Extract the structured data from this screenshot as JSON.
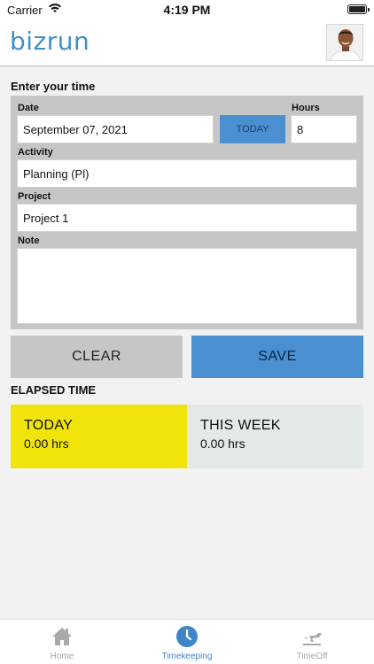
{
  "status_bar": {
    "carrier": "Carrier",
    "time": "4:19 PM"
  },
  "header": {
    "logo": "bizrun"
  },
  "entry": {
    "title": "Enter your time",
    "date_label": "Date",
    "date_value": "September 07, 2021",
    "today_button": "TODAY",
    "hours_label": "Hours",
    "hours_value": "8",
    "activity_label": "Activity",
    "activity_value": "Planning (Pl)",
    "project_label": "Project",
    "project_value": "Project 1",
    "note_label": "Note",
    "note_value": ""
  },
  "actions": {
    "clear": "CLEAR",
    "save": "SAVE"
  },
  "elapsed": {
    "title": "ELAPSED TIME",
    "today_label": "TODAY",
    "today_value": "0.00 hrs",
    "week_label": "THIS WEEK",
    "week_value": "0.00 hrs"
  },
  "tabs": [
    {
      "label": "Home",
      "icon": "home-icon",
      "active": false
    },
    {
      "label": "Timekeeping",
      "icon": "clock-icon",
      "active": true
    },
    {
      "label": "TimeOff",
      "icon": "airplane-icon",
      "active": false
    }
  ],
  "colors": {
    "brand": "#3e8fca",
    "accent": "#4a90d0",
    "today_card": "#f0e40a",
    "week_card": "#e3e9e5",
    "panel": "#c6c6c6"
  }
}
